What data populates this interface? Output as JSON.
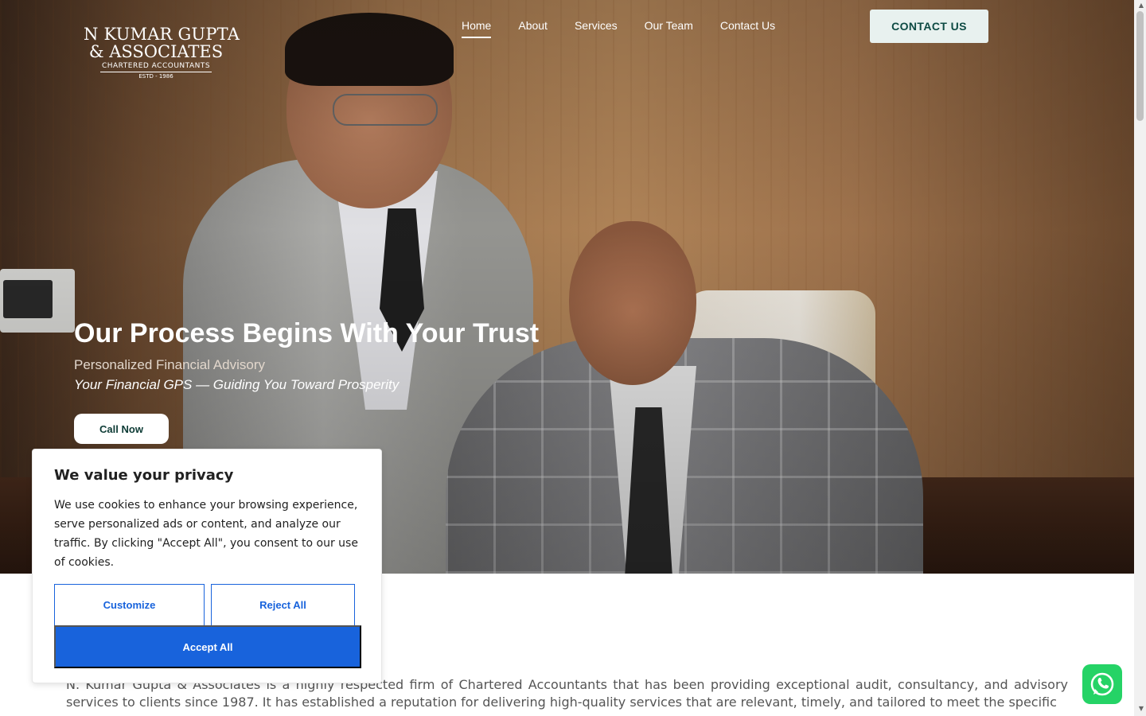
{
  "header": {
    "logo": {
      "line1": "N KUMAR GUPTA",
      "line2": "& ASSOCIATES",
      "line3": "CHARTERED ACCOUNTANTS",
      "line4": "ESTD - 1986"
    },
    "nav": [
      {
        "label": "Home",
        "active": true
      },
      {
        "label": "About"
      },
      {
        "label": "Services"
      },
      {
        "label": "Our Team"
      },
      {
        "label": "Contact Us"
      }
    ],
    "contact_button": "CONTACT US"
  },
  "hero": {
    "title": "Our Process Begins With Your Trust",
    "subtitle": "Personalized Financial Advisory",
    "tagline": "Your Financial GPS — Guiding You Toward Prosperity",
    "call_button": "Call Now"
  },
  "about": {
    "text": "N. Kumar Gupta & Associates is a highly respected firm of Chartered Accountants that has been providing exceptional audit, consultancy, and advisory services to clients since 1987. It has established a reputation for delivering high-quality services that are relevant, timely, and tailored to meet the specific"
  },
  "cookie_banner": {
    "title": "We value your privacy",
    "text": "We use cookies to enhance your browsing experience, serve personalized ads or content, and analyze our traffic. By clicking \"Accept All\", you consent to our use of cookies.",
    "customize": "Customize",
    "reject": "Reject All",
    "accept": "Accept All"
  },
  "icons": {
    "whatsapp": "whatsapp-icon"
  },
  "colors": {
    "accent": "#1863dc",
    "brand": "#0d4a43",
    "whatsapp": "#25d366"
  }
}
